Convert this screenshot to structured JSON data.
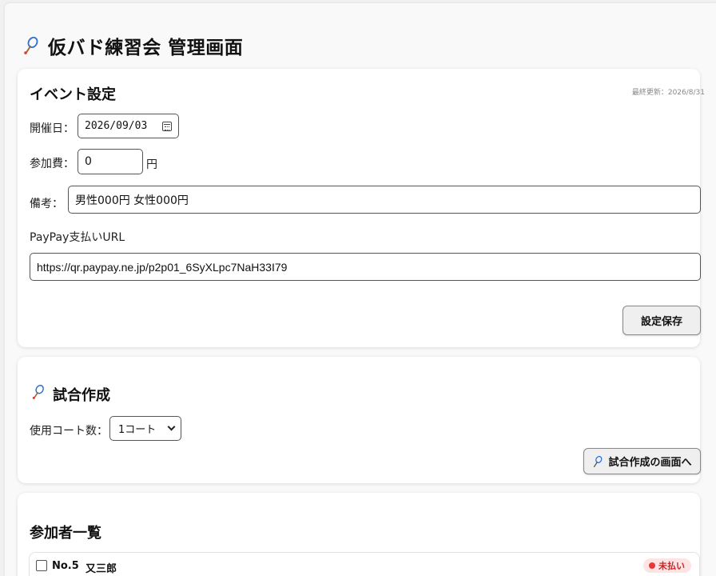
{
  "header": {
    "title": "仮バド練習会 管理画面",
    "icon": "badminton-racket-icon"
  },
  "event_settings": {
    "title": "イベント設定",
    "last_updated": "最終更新：2026/8/31",
    "date_label": "開催日：",
    "date_value": "2026/09/03",
    "fee_label": "参加費：",
    "fee_value": "0",
    "fee_unit": "円",
    "note_label": "備考：",
    "note_value": "男性000円 女性000円",
    "paypay_label": "PayPay支払いURL",
    "paypay_value": "https://qr.paypay.ne.jp/p2p01_6SyXLpc7NaH33I79",
    "save_button": "設定保存"
  },
  "match": {
    "title": "試合作成",
    "courts_label": "使用コート数：",
    "courts_selected": "1コート",
    "go_button": "試合作成の画面へ"
  },
  "participants": {
    "title": "参加者一覧",
    "items": [
      {
        "no": "No.5",
        "name": "又三郎",
        "status": "未払い"
      }
    ]
  },
  "colors": {
    "accent_blue": "#2f6fd6",
    "unpaid_red": "#e53935",
    "unpaid_bg": "#fde3e3"
  }
}
